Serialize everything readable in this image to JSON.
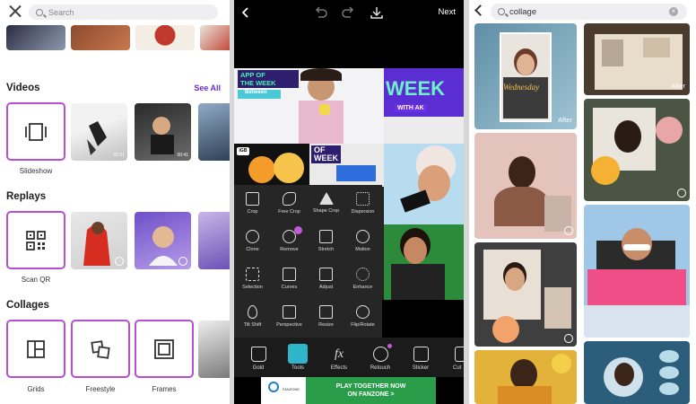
{
  "left_panel": {
    "search": {
      "placeholder": "Search"
    },
    "videos": {
      "title": "Videos",
      "see_all": "See All",
      "tool_label": "Slideshow",
      "durations": [
        "01:21",
        "00:41"
      ]
    },
    "replays": {
      "title": "Replays",
      "tool_label": "Scan QR"
    },
    "collages": {
      "title": "Collages",
      "tools": [
        "Grids",
        "Freestyle",
        "Frames"
      ]
    }
  },
  "middle_panel": {
    "next_label": "Next",
    "canvas_texts": {
      "sticker_line1": "APP OF",
      "sticker_line2": "THE WEEK",
      "week": "WEEK",
      "with_ak": "WITH AK",
      "between": "Between",
      "of_week_1": "OF",
      "of_week_2": "WEEK",
      "badge": "iGB"
    },
    "tools": [
      [
        "Crop",
        "Free Crop",
        "Shape Crop",
        "Dispersion"
      ],
      [
        "Clone",
        "Remove",
        "Stretch",
        "Motion"
      ],
      [
        "Selection",
        "Curves",
        "Adjust",
        "Enhance"
      ],
      [
        "Tilt Shift",
        "Perspective",
        "Resize",
        "Flip/Rotate"
      ]
    ],
    "bottom_bar": [
      "Gold",
      "Tools",
      "Effects",
      "Retouch",
      "Sticker",
      "Cut"
    ],
    "ad": {
      "line1": "PLAY TOGETHER NOW",
      "line2": "ON FANZONE >",
      "brand": "FANZONE"
    }
  },
  "right_panel": {
    "search_value": "collage",
    "wednesday": "Wednesday",
    "after_label": "After"
  },
  "colors": {
    "accent": "#6a2bd6",
    "tool_border": "#b84fd3",
    "active_tool": "#2fb5c9",
    "ad_bg": "#2a9d4a"
  }
}
